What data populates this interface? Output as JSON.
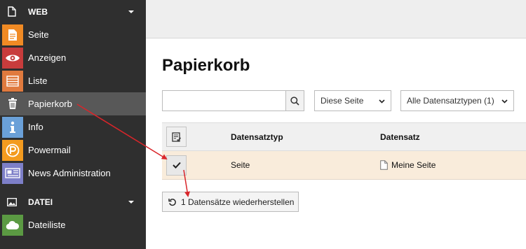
{
  "sidebar": {
    "groups": [
      {
        "label": "WEB",
        "items": [
          {
            "label": "Seite",
            "icon": "page-icon",
            "color": "#f08a24"
          },
          {
            "label": "Anzeigen",
            "icon": "eye-icon",
            "color": "#c83c3c"
          },
          {
            "label": "Liste",
            "icon": "list-icon",
            "color": "#e07a3e"
          },
          {
            "label": "Papierkorb",
            "icon": "trash-icon",
            "color": "#585858"
          },
          {
            "label": "Info",
            "icon": "info-icon",
            "color": "#6aa0d8"
          },
          {
            "label": "Powermail",
            "icon": "powermail-icon",
            "color": "#f39b1f"
          },
          {
            "label": "News Administration",
            "icon": "news-icon",
            "color": "#7d7fc8"
          }
        ]
      },
      {
        "label": "DATEI",
        "items": [
          {
            "label": "Dateiliste",
            "icon": "cloud-icon",
            "color": "#5b9a43"
          }
        ]
      }
    ]
  },
  "main": {
    "title": "Papierkorb",
    "search": {
      "value": "",
      "placeholder": ""
    },
    "depth_select": "Diese Seite",
    "type_select": "Alle Datensatztypen (1)",
    "table": {
      "headers": {
        "type": "Datensatztyp",
        "record": "Datensatz"
      },
      "rows": [
        {
          "type": "Seite",
          "record": "Meine Seite"
        }
      ]
    },
    "restore_button": "1 Datensätze wiederherstellen"
  },
  "colors": {
    "sidebar_bg": "#2f2f2f",
    "active_bg": "#585858",
    "row_highlight": "#f9ecdb",
    "arrow": "#d9252a"
  }
}
